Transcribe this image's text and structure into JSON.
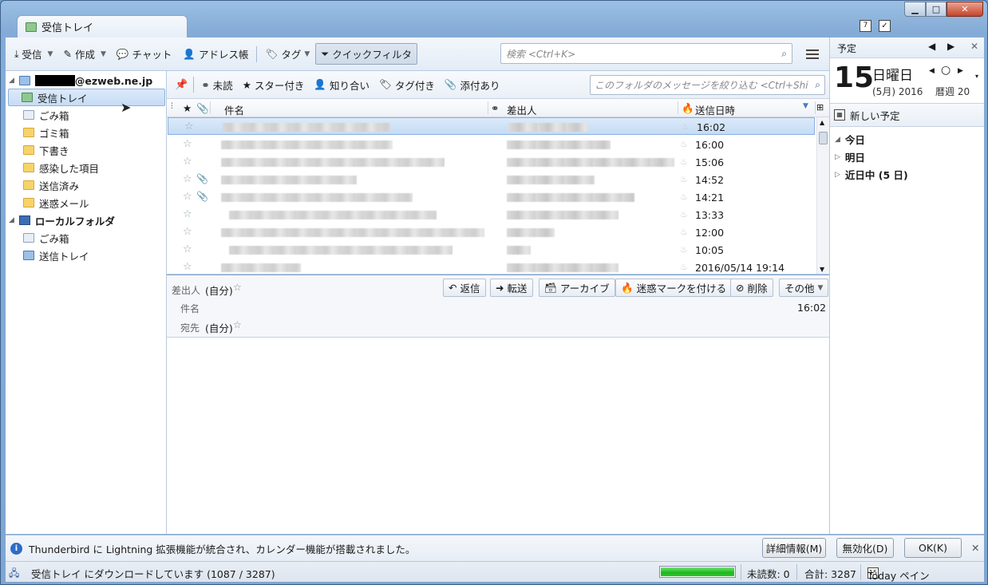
{
  "window": {
    "tab_title": "受信トレイ",
    "controls": {
      "minimize": "▁",
      "maximize": "□",
      "close": "✕"
    }
  },
  "toolbar": {
    "get_mail": "受信",
    "write": "作成",
    "chat": "チャット",
    "address_book": "アドレス帳",
    "tag": "タグ",
    "quick_filter": "クイックフィルタ",
    "search_placeholder": "検索 <Ctrl+K>"
  },
  "folders": {
    "account": "@ezweb.ne.jp",
    "items": [
      {
        "label": "受信トレイ",
        "icon": "inbox-icon",
        "selected": true
      },
      {
        "label": "ごみ箱",
        "icon": "trash-icon"
      },
      {
        "label": "ゴミ箱",
        "icon": "folder-icon"
      },
      {
        "label": "下書き",
        "icon": "folder-icon"
      },
      {
        "label": "感染した項目",
        "icon": "folder-icon"
      },
      {
        "label": "送信済み",
        "icon": "folder-icon"
      },
      {
        "label": "迷惑メール",
        "icon": "folder-icon"
      }
    ],
    "local": "ローカルフォルダ",
    "local_items": [
      {
        "label": "ごみ箱",
        "icon": "trash-icon"
      },
      {
        "label": "送信トレイ",
        "icon": "outbox-icon"
      }
    ]
  },
  "quickfilter": {
    "unread": "未読",
    "starred": "スター付き",
    "contacts": "知り合い",
    "tagged": "タグ付き",
    "attachment": "添付あり",
    "filter_placeholder": "このフォルダのメッセージを絞り込む <Ctrl+Shift+K>"
  },
  "columns": {
    "subject": "件名",
    "sender": "差出人",
    "date": "送信日時"
  },
  "messages": [
    {
      "date": "16:02",
      "attachment": false,
      "selected": true
    },
    {
      "date": "16:00",
      "attachment": false
    },
    {
      "date": "15:06",
      "attachment": false
    },
    {
      "date": "14:52",
      "attachment": true
    },
    {
      "date": "14:21",
      "attachment": true
    },
    {
      "date": "13:33",
      "attachment": false
    },
    {
      "date": "12:00",
      "attachment": false
    },
    {
      "date": "10:05",
      "attachment": false
    },
    {
      "date": "2016/05/14 19:14",
      "attachment": false
    }
  ],
  "preview": {
    "from_label": "差出人",
    "from_value": "(自分)",
    "subject_label": "件名",
    "to_label": "宛先",
    "to_value": "(自分)",
    "time": "16:02",
    "buttons": {
      "reply": "返信",
      "forward": "転送",
      "archive": "アーカイブ",
      "junk": "迷惑マークを付ける",
      "delete": "削除",
      "other": "その他"
    }
  },
  "today_pane": {
    "title": "予定",
    "day": "15",
    "weekday": "日曜日",
    "month_year": "(5月) 2016",
    "week": "暦週 20",
    "new_event": "新しい予定",
    "groups": [
      "今日",
      "明日",
      "近日中 (5 日)"
    ]
  },
  "notification": {
    "text": "Thunderbird に Lightning 拡張機能が統合され、カレンダー機能が搭載されました。",
    "details": "詳細情報(M)",
    "disable": "無効化(D)",
    "ok": "OK(K)"
  },
  "status": {
    "text": "受信トレイ にダウンロードしています (1087 / 3287)",
    "progress": 1.0,
    "unread": "未読数: 0",
    "total": "合計: 3287",
    "today_pane": "Today ペイン"
  },
  "colors": {
    "accent": "#3c6eb4",
    "selection": "#c5dcf5",
    "progress": "#1fb61f"
  }
}
